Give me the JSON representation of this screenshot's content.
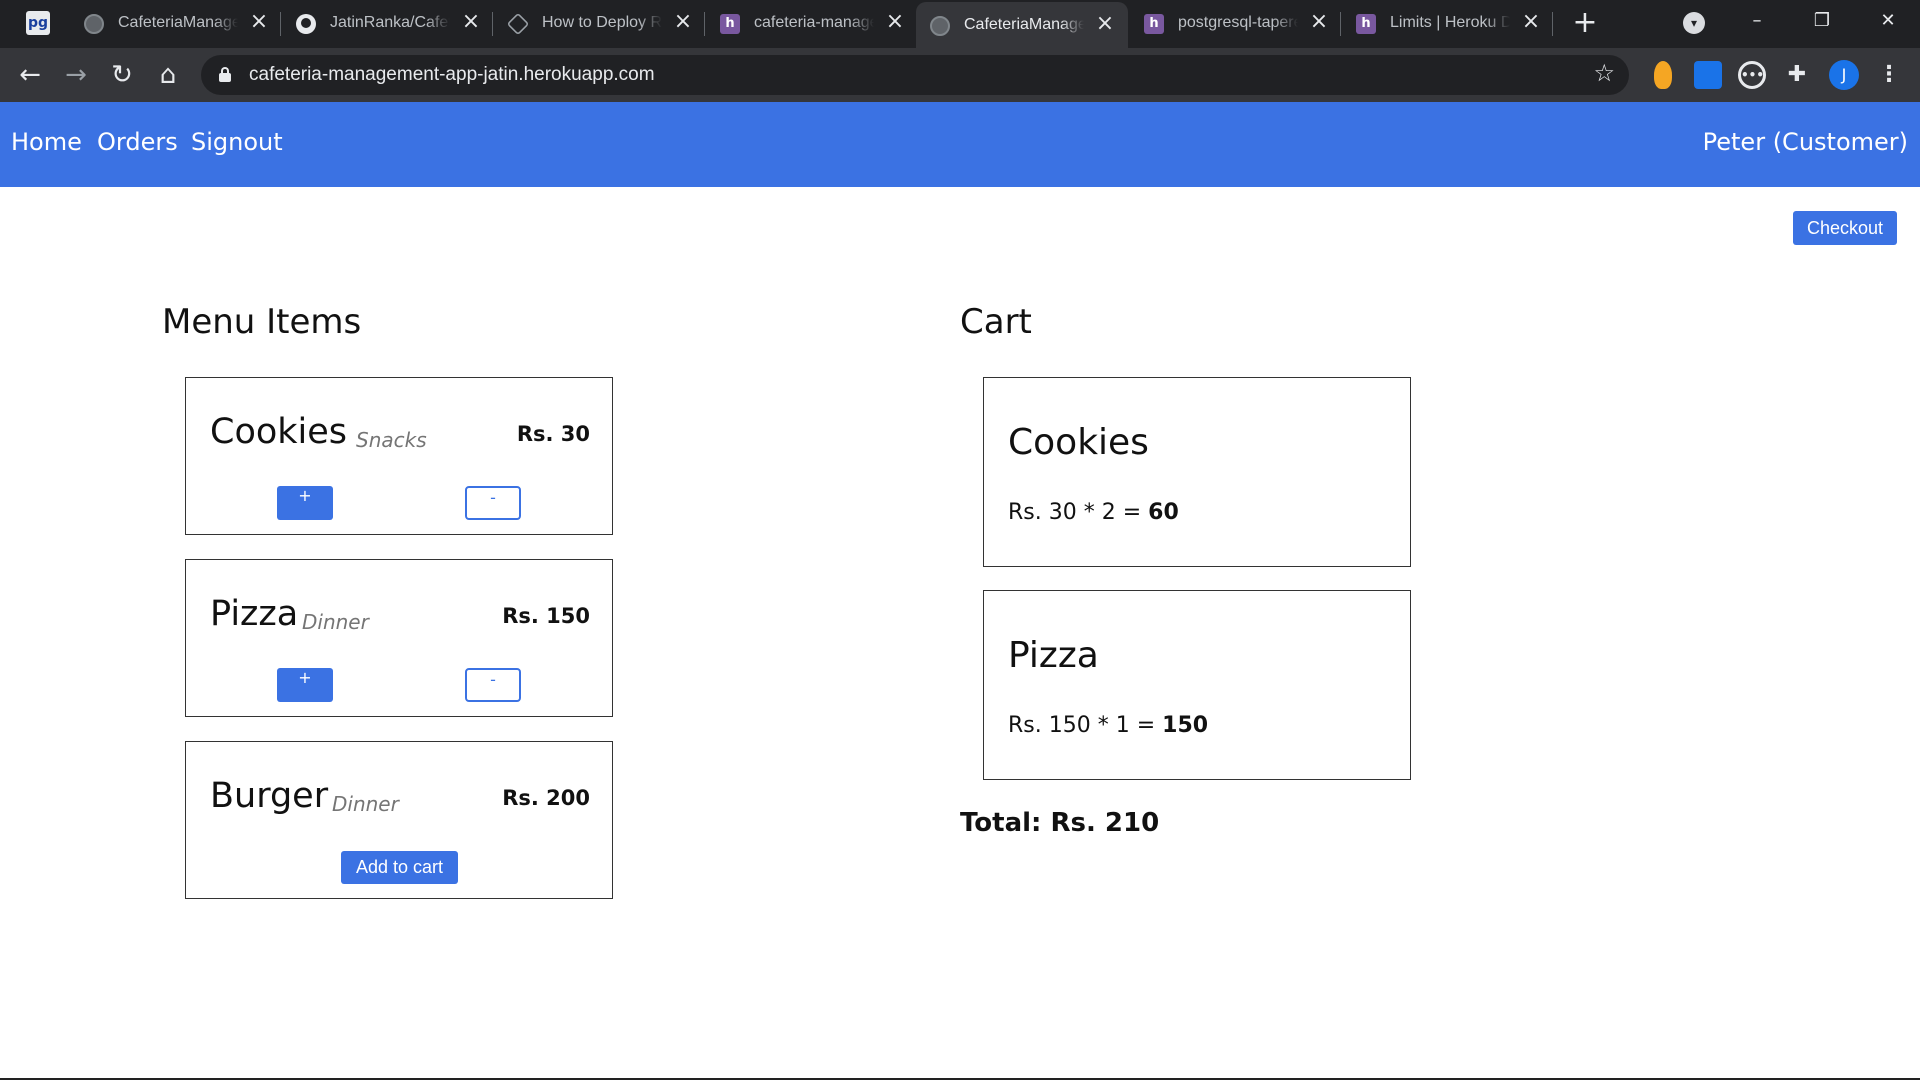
{
  "browser": {
    "tabs": [
      {
        "title": "CafeteriaManagement",
        "favicon": "globe-icon"
      },
      {
        "title": "JatinRanka/CafeteriaManagement",
        "favicon": "github-icon"
      },
      {
        "title": "How to Deploy Rails",
        "favicon": "graphql-icon"
      },
      {
        "title": "cafeteria-management",
        "favicon": "heroku-icon"
      },
      {
        "title": "CafeteriaManagement",
        "favicon": "globe-icon"
      },
      {
        "title": "postgresql-tapered",
        "favicon": "heroku-icon"
      },
      {
        "title": "Limits | Heroku Dev Center",
        "favicon": "heroku-icon"
      }
    ],
    "active_tab_index": 4,
    "pinned_icon_text": "pg",
    "url": "cafeteria-management-app-jatin.herokuapp.com",
    "profile_initial": "J"
  },
  "nav": {
    "links": [
      "Home",
      "Orders",
      "Signout"
    ],
    "user": "Peter (Customer)"
  },
  "checkout_label": "Checkout",
  "menu": {
    "heading": "Menu Items",
    "items": [
      {
        "name": "Cookies",
        "category": "Snacks",
        "price": "Rs. 30",
        "plus": "+",
        "minus": "-"
      },
      {
        "name": "Pizza",
        "category": "Dinner",
        "price": "Rs. 150",
        "plus": "+",
        "minus": "-"
      },
      {
        "name": "Burger",
        "category": "Dinner",
        "price": "Rs. 200",
        "add_label": "Add to cart"
      }
    ]
  },
  "cart": {
    "heading": "Cart",
    "items": [
      {
        "name": "Cookies",
        "calc": "Rs. 30 * 2 = ",
        "subtotal": "60"
      },
      {
        "name": "Pizza",
        "calc": "Rs. 150 * 1 = ",
        "subtotal": "150"
      }
    ],
    "total": "Total: Rs. 210"
  },
  "colors": {
    "navbar": "#3b72e3",
    "primary_button": "#3b72e3",
    "browser_frame": "#202124"
  }
}
